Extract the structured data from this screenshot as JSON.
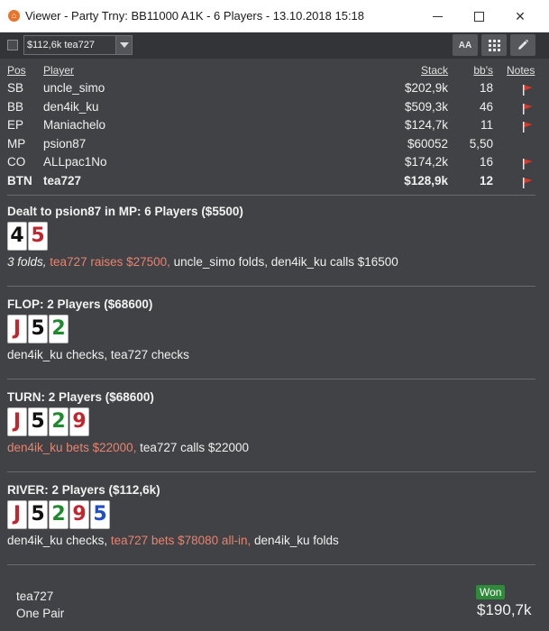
{
  "window": {
    "title": "Viewer - Party Trny: BB11000 A1K - 6 Players - 13.10.2018 15:18",
    "icon": "app-logo-icon",
    "controls": [
      "minimize-icon",
      "maximize-icon",
      "close-icon"
    ]
  },
  "toolbar": {
    "hand_select_value": "$112,6k tea727",
    "aa_label": "AA",
    "buttons": [
      "font-size-icon",
      "grid-icon",
      "pencil-icon"
    ]
  },
  "players": {
    "headers": {
      "pos": "Pos",
      "player": "Player",
      "stack": "Stack",
      "bbs": "bb's",
      "notes": "Notes"
    },
    "rows": [
      {
        "pos": "SB",
        "name": "uncle_simo",
        "stack": "$202,9k",
        "bbs": "18",
        "flag": true
      },
      {
        "pos": "BB",
        "name": "den4ik_ku",
        "stack": "$509,3k",
        "bbs": "46",
        "flag": true
      },
      {
        "pos": "EP",
        "name": "Maniachelo",
        "stack": "$124,7k",
        "bbs": "11",
        "flag": true
      },
      {
        "pos": "MP",
        "name": "psion87",
        "stack": "$60052",
        "bbs": "5,50",
        "flag": false
      },
      {
        "pos": "CO",
        "name": "ALLpac1No",
        "stack": "$174,2k",
        "bbs": "16",
        "flag": true
      },
      {
        "pos": "BTN",
        "name": "tea727",
        "stack": "$128,9k",
        "bbs": "12",
        "flag": true,
        "hero": true
      }
    ]
  },
  "streets": [
    {
      "title": "Dealt to psion87 in MP: 6 Players ($5500)",
      "cards": [
        {
          "rank": "4",
          "suit": "s"
        },
        {
          "rank": "5",
          "suit": "h"
        }
      ],
      "action": [
        {
          "text": "3 folds, ",
          "style": "i"
        },
        {
          "text": "tea727 raises $27500, ",
          "style": "r"
        },
        {
          "text": "uncle_simo folds, den4ik_ku calls $16500",
          "style": "w"
        }
      ]
    },
    {
      "title": "FLOP: 2 Players ($68600)",
      "cards": [
        {
          "rank": "J",
          "suit": "h"
        },
        {
          "rank": "5",
          "suit": "s"
        },
        {
          "rank": "2",
          "suit": "c"
        }
      ],
      "action": [
        {
          "text": "den4ik_ku checks, tea727 checks",
          "style": "w"
        }
      ]
    },
    {
      "title": "TURN: 2 Players ($68600)",
      "cards": [
        {
          "rank": "J",
          "suit": "h"
        },
        {
          "rank": "5",
          "suit": "s"
        },
        {
          "rank": "2",
          "suit": "c"
        },
        {
          "rank": "9",
          "suit": "h"
        }
      ],
      "action": [
        {
          "text": "den4ik_ku bets $22000, ",
          "style": "r"
        },
        {
          "text": "tea727 calls $22000",
          "style": "w"
        }
      ]
    },
    {
      "title": "RIVER: 2 Players ($112,6k)",
      "cards": [
        {
          "rank": "J",
          "suit": "h"
        },
        {
          "rank": "5",
          "suit": "s"
        },
        {
          "rank": "2",
          "suit": "c"
        },
        {
          "rank": "9",
          "suit": "h"
        },
        {
          "rank": "5",
          "suit": "d"
        }
      ],
      "action": [
        {
          "text": "den4ik_ku checks, ",
          "style": "w"
        },
        {
          "text": "tea727 bets $78080 all-in, ",
          "style": "r"
        },
        {
          "text": "den4ik_ku folds",
          "style": "w"
        }
      ]
    }
  ],
  "result": {
    "player": "tea727",
    "hand": "One Pair",
    "badge": "Won",
    "amount": "$190,7k"
  },
  "colors": {
    "panel_bg": "#414245",
    "toolbar_bg": "#333437",
    "raise_text": "#e8836f",
    "won_badge": "#2e8b3a",
    "flag_red": "#d63a2a"
  }
}
